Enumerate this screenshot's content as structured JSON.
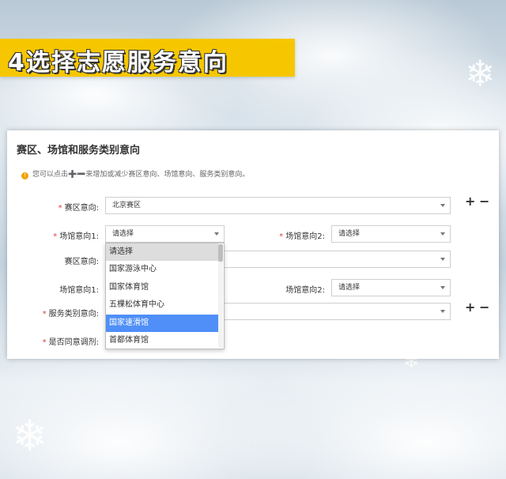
{
  "banner": {
    "text": "4选择志愿服务意向"
  },
  "panel": {
    "title": "赛区、场馆和服务类别意向",
    "hint": "您可以点击➕➖来增加或减少赛区意向、场馆意向、服务类别意向。",
    "hint_icon": "info-icon"
  },
  "form": {
    "rows": [
      {
        "label": "赛区意向:",
        "required": true,
        "value": "北京赛区"
      },
      {
        "label": "场馆意向1:",
        "required": true,
        "value": "请选择"
      },
      {
        "label": "场馆意向2:",
        "required": true,
        "value": "请选择"
      },
      {
        "label": "赛区意向:",
        "required": false,
        "value": ""
      },
      {
        "label": "场馆意向1:",
        "required": false,
        "value": ""
      },
      {
        "label": "场馆意向2:",
        "required": false,
        "value": "请选择"
      },
      {
        "label": "服务类别意向:",
        "required": true,
        "value": ""
      },
      {
        "label": "是否同意调剂:",
        "required": true,
        "value": ""
      }
    ],
    "plus": "+",
    "minus": "−",
    "req_mark": "*"
  },
  "dropdown": {
    "options": [
      "请选择",
      "国家游泳中心",
      "国家体育馆",
      "五棵松体育中心",
      "国家速滑馆",
      "首都体育馆"
    ],
    "highlighted_index": 4,
    "placeholder_index": 0
  },
  "colors": {
    "accent": "#f6c700",
    "required": "#e23b3b",
    "highlight": "#4f8ff7"
  }
}
